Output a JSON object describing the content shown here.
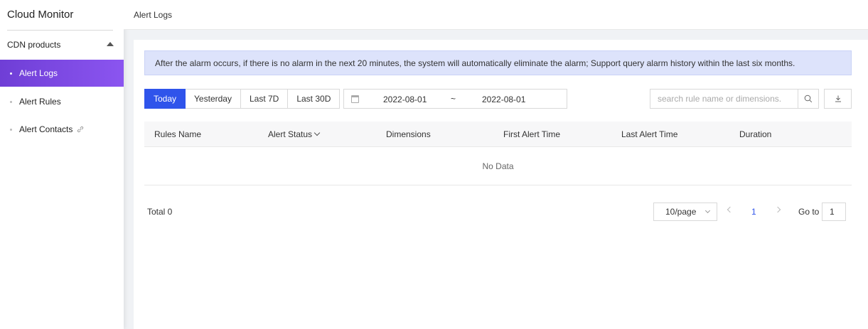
{
  "sidebar": {
    "title": "Cloud Monitor",
    "section": "CDN products",
    "items": [
      {
        "label": "Alert Logs"
      },
      {
        "label": "Alert Rules"
      },
      {
        "label": "Alert Contacts"
      }
    ]
  },
  "header": {
    "title": "Alert Logs"
  },
  "notice": "After the alarm occurs, if there is no alarm in the next 20 minutes, the system will automatically eliminate the alarm; Support query alarm history within the last six months.",
  "filters": {
    "ranges": [
      "Today",
      "Yesterday",
      "Last 7D",
      "Last 30D"
    ],
    "active_range": "Today",
    "date_start": "2022-08-01",
    "date_separator": "~",
    "date_end": "2022-08-01",
    "search_placeholder": "search rule name or dimensions."
  },
  "table": {
    "columns": [
      "Rules Name",
      "Alert Status",
      "Dimensions",
      "First Alert Time",
      "Last Alert Time",
      "Duration"
    ],
    "empty_text": "No Data"
  },
  "pagination": {
    "total": "Total 0",
    "page_size": "10/page",
    "current_page": "1",
    "goto_label": "Go to",
    "goto_value": "1"
  },
  "colors": {
    "accent": "#2f54eb",
    "sidebar_active_start": "#6f3ed6",
    "sidebar_active_end": "#8b55f0",
    "notice_bg": "#dde3fb"
  }
}
